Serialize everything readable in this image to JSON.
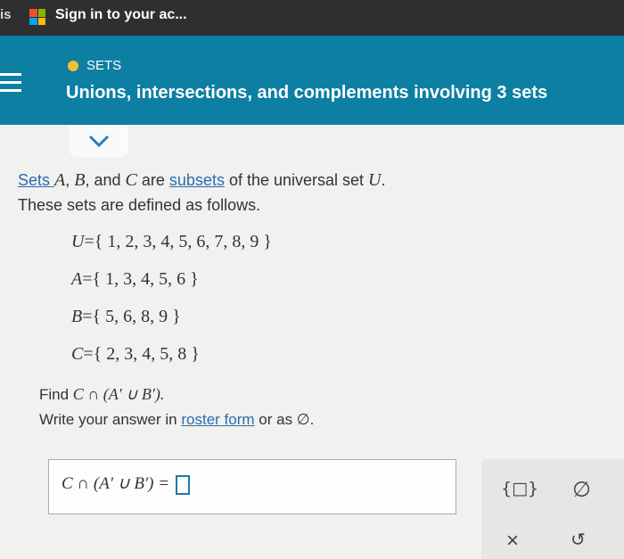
{
  "browser": {
    "tab_edge": "is",
    "tab_title": "Sign in to your ac...",
    "logo_colors": [
      "#f25022",
      "#7fba00",
      "#00a4ef",
      "#ffb900"
    ]
  },
  "header": {
    "topic_label": "SETS",
    "title": "Unions, intersections, and complements involving 3 sets",
    "topic_dot_color": "#f4c12e"
  },
  "question": {
    "intro_parts": [
      "Sets ",
      "A",
      ", ",
      "B",
      ", and ",
      "C",
      " are ",
      "subsets",
      " of the universal set ",
      "U",
      "."
    ],
    "line2": "These sets are defined as follows.",
    "sets": [
      {
        "name": "U",
        "elements": "{ 1, 2, 3, 4, 5, 6, 7, 8, 9 }"
      },
      {
        "name": "A",
        "elements": "{ 1, 3, 4, 5, 6 }"
      },
      {
        "name": "B",
        "elements": "{ 5, 6, 8, 9 }"
      },
      {
        "name": "C",
        "elements": "{ 2, 3, 4, 5, 8 }"
      }
    ],
    "find_prefix": "Find ",
    "find_expr": "C ∩ (A′ ∪ B′).",
    "write_prefix": "Write your answer in ",
    "write_link": "roster form",
    "write_suffix": " or as ∅."
  },
  "answer": {
    "prompt": "C ∩ (A′ ∪ B′) = "
  },
  "tools": {
    "braces_label": "{□}",
    "empty_set_label": "∅",
    "clear_label": "×",
    "undo_label": "↺"
  }
}
